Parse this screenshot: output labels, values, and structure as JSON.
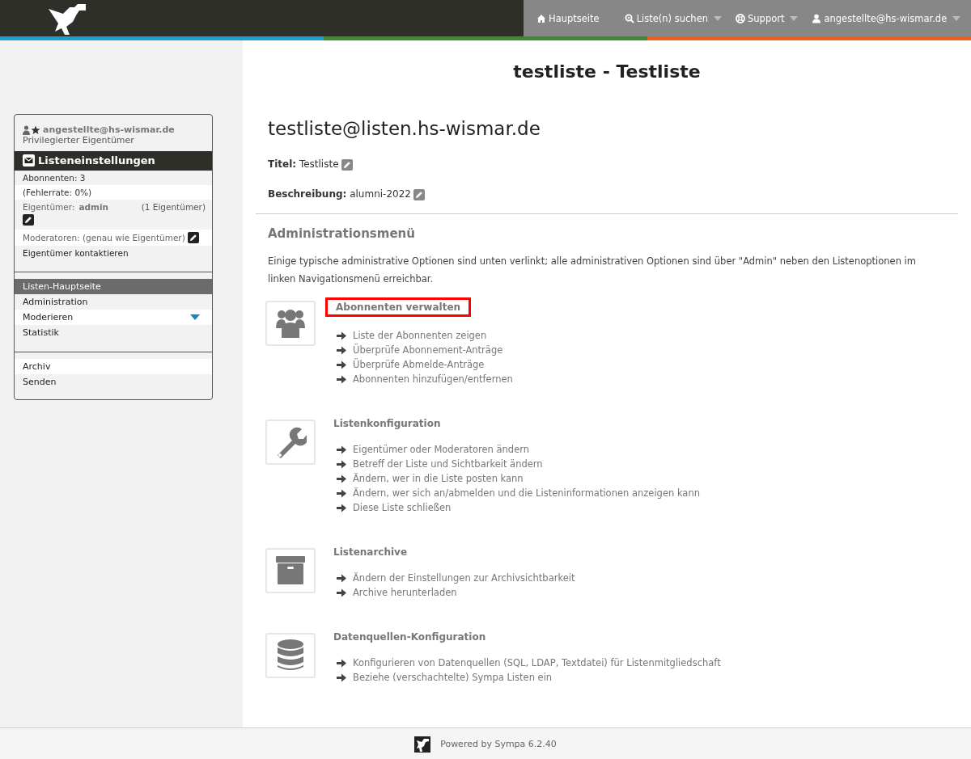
{
  "topbar": {
    "nav": [
      {
        "kind": "home",
        "label": "Hauptseite",
        "dropdown": false
      },
      {
        "kind": "search",
        "label": "Liste(n) suchen",
        "dropdown": true
      },
      {
        "kind": "support",
        "label": "Support",
        "dropdown": true
      },
      {
        "kind": "user",
        "label": "angestellte@hs-wismar.de",
        "dropdown": true
      }
    ]
  },
  "page_title": "testliste - Testliste",
  "sidebar": {
    "user": {
      "email": "angestellte@hs-wismar.de",
      "role": "Privilegierter Eigentümer"
    },
    "settings_header": "Listeneinstellungen",
    "info": [
      {
        "kind": "text",
        "text": "Abonnenten: 3"
      },
      {
        "kind": "text",
        "text": "(Fehlerrate: 0%)"
      },
      {
        "kind": "owner",
        "label": "Eigentümer:",
        "value": "admin",
        "count": "(1 Eigentümer)"
      },
      {
        "kind": "editable",
        "text": "Moderatoren: (genau wie Eigentümer)"
      },
      {
        "kind": "link",
        "text": "Eigentümer kontaktieren"
      }
    ],
    "nav": [
      {
        "label": "Listen-Hauptseite",
        "selected": true,
        "expandable": false
      },
      {
        "label": "Administration",
        "selected": false,
        "expandable": false
      },
      {
        "label": "Moderieren",
        "selected": false,
        "expandable": true
      },
      {
        "label": "Statistik",
        "selected": false,
        "expandable": false
      }
    ],
    "nav2": [
      {
        "label": "Archiv",
        "selected": false
      },
      {
        "label": "Senden",
        "selected": false
      }
    ]
  },
  "main": {
    "address": "testliste@listen.hs-wismar.de",
    "fields": [
      {
        "label": "Titel:",
        "value": "Testliste"
      },
      {
        "label": "Beschreibung:",
        "value": "alumni-2022"
      }
    ],
    "admin_title": "Administrationsmenü",
    "intro": "Einige typische administrative Optionen sind unten verlinkt; alle administrativen Optionen sind über \"Admin\" neben den Listenoptionen im linken Navigationsmenü erreichbar.",
    "sections": [
      {
        "kind": "users",
        "title": "Abonnenten verwalten",
        "highlighted": true,
        "links": [
          "Liste der Abonnenten zeigen",
          "Überprüfe Abonnement-Anträge",
          "Überprüfe Abmelde-Anträge",
          "Abonnenten hinzufügen/entfernen"
        ]
      },
      {
        "kind": "wrench",
        "title": "Listenkonfiguration",
        "highlighted": false,
        "links": [
          "Eigentümer oder Moderatoren ändern",
          "Betreff der Liste und Sichtbarkeit ändern",
          "Ändern, wer in die Liste posten kann",
          "Ändern, wer sich an/abmelden und die Listeninformationen anzeigen kann",
          "Diese Liste schließen"
        ]
      },
      {
        "kind": "archive",
        "title": "Listenarchive",
        "highlighted": false,
        "links": [
          "Ändern der Einstellungen zur Archivsichtbarkeit",
          "Archive herunterladen"
        ]
      },
      {
        "kind": "database",
        "title": "Datenquellen-Konfiguration",
        "highlighted": false,
        "links": [
          "Konfigurieren von Datenquellen (SQL, LDAP, Textdatei) für Listenmitgliedschaft",
          "Beziehe (verschachtelte) Sympa Listen ein"
        ]
      }
    ]
  },
  "footer": {
    "text": "Powered by Sympa 6.2.40"
  }
}
